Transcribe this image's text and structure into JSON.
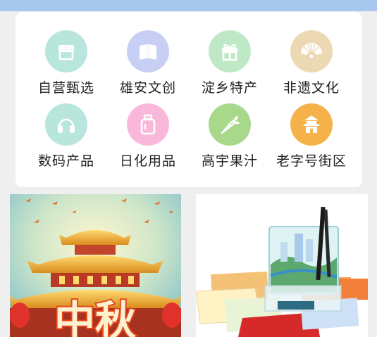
{
  "categories": [
    {
      "label": "自营甄选",
      "icon": "store-icon",
      "color": "#b9e6dc"
    },
    {
      "label": "雄安文创",
      "icon": "book-icon",
      "color": "#c8cff4"
    },
    {
      "label": "淀乡特产",
      "icon": "gift-icon",
      "color": "#bfe9c6"
    },
    {
      "label": "非遗文化",
      "icon": "folding-fan-icon",
      "color": "#ecd9b3"
    },
    {
      "label": "数码产品",
      "icon": "headphones-icon",
      "color": "#b9e6dc"
    },
    {
      "label": "日化用品",
      "icon": "bottle-icon",
      "color": "#f9b8da"
    },
    {
      "label": "高宇果汁",
      "icon": "carrot-icon",
      "color": "#a8d98a"
    },
    {
      "label": "老字号街区",
      "icon": "pagoda-icon",
      "color": "#f6b24a"
    }
  ],
  "banners": [
    {
      "text": "中秋",
      "icon": "mid-autumn-palace-banner"
    },
    {
      "icon": "stationery-pen-holder-banner"
    }
  ]
}
